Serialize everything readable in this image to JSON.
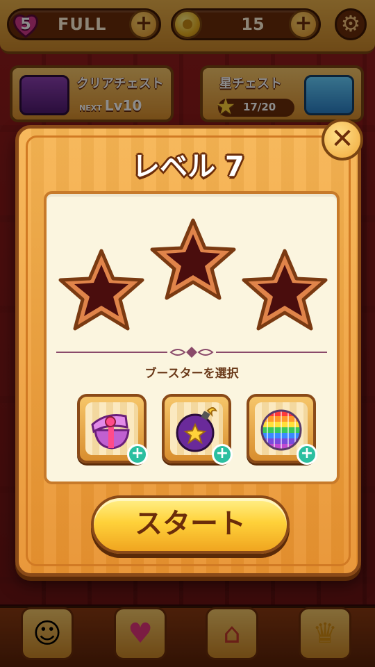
{
  "top_bar": {
    "lives_count": "5",
    "lives_status": "FULL",
    "coins": "15",
    "add_lives_icon": "plus-icon",
    "add_coins_icon": "plus-icon",
    "settings_icon": "gear-icon"
  },
  "chests": {
    "clear_chest": {
      "title": "クリアチェスト",
      "next_prefix": "NEXT",
      "next_level": "Lv10"
    },
    "star_chest": {
      "title": "星チェスト",
      "progress": "17/20"
    }
  },
  "dialog": {
    "title": "レベル 7",
    "close_symbol": "✕",
    "stars_earned": 0,
    "stars_total": 3,
    "booster_label": "ブースターを選択",
    "boosters": [
      {
        "name": "gift-box-booster",
        "icon": "gift-box-icon",
        "add": "+"
      },
      {
        "name": "bomb-booster",
        "icon": "star-bomb-icon",
        "add": "+"
      },
      {
        "name": "disco-ball-booster",
        "icon": "rainbow-disco-ball-icon",
        "add": "+"
      }
    ],
    "start_label": "スタート"
  },
  "bottom_nav": [
    {
      "name": "character",
      "icon": "character-icon"
    },
    {
      "name": "lives",
      "icon": "heart-icon"
    },
    {
      "name": "home",
      "icon": "home-icon"
    },
    {
      "name": "trophy",
      "icon": "trophy-icon"
    }
  ],
  "colors": {
    "accent_orange": "#e8922f",
    "frame_brown": "#8a4a18",
    "start_yellow": "#ffd23a",
    "booster_add_green": "#2bbfa0"
  }
}
